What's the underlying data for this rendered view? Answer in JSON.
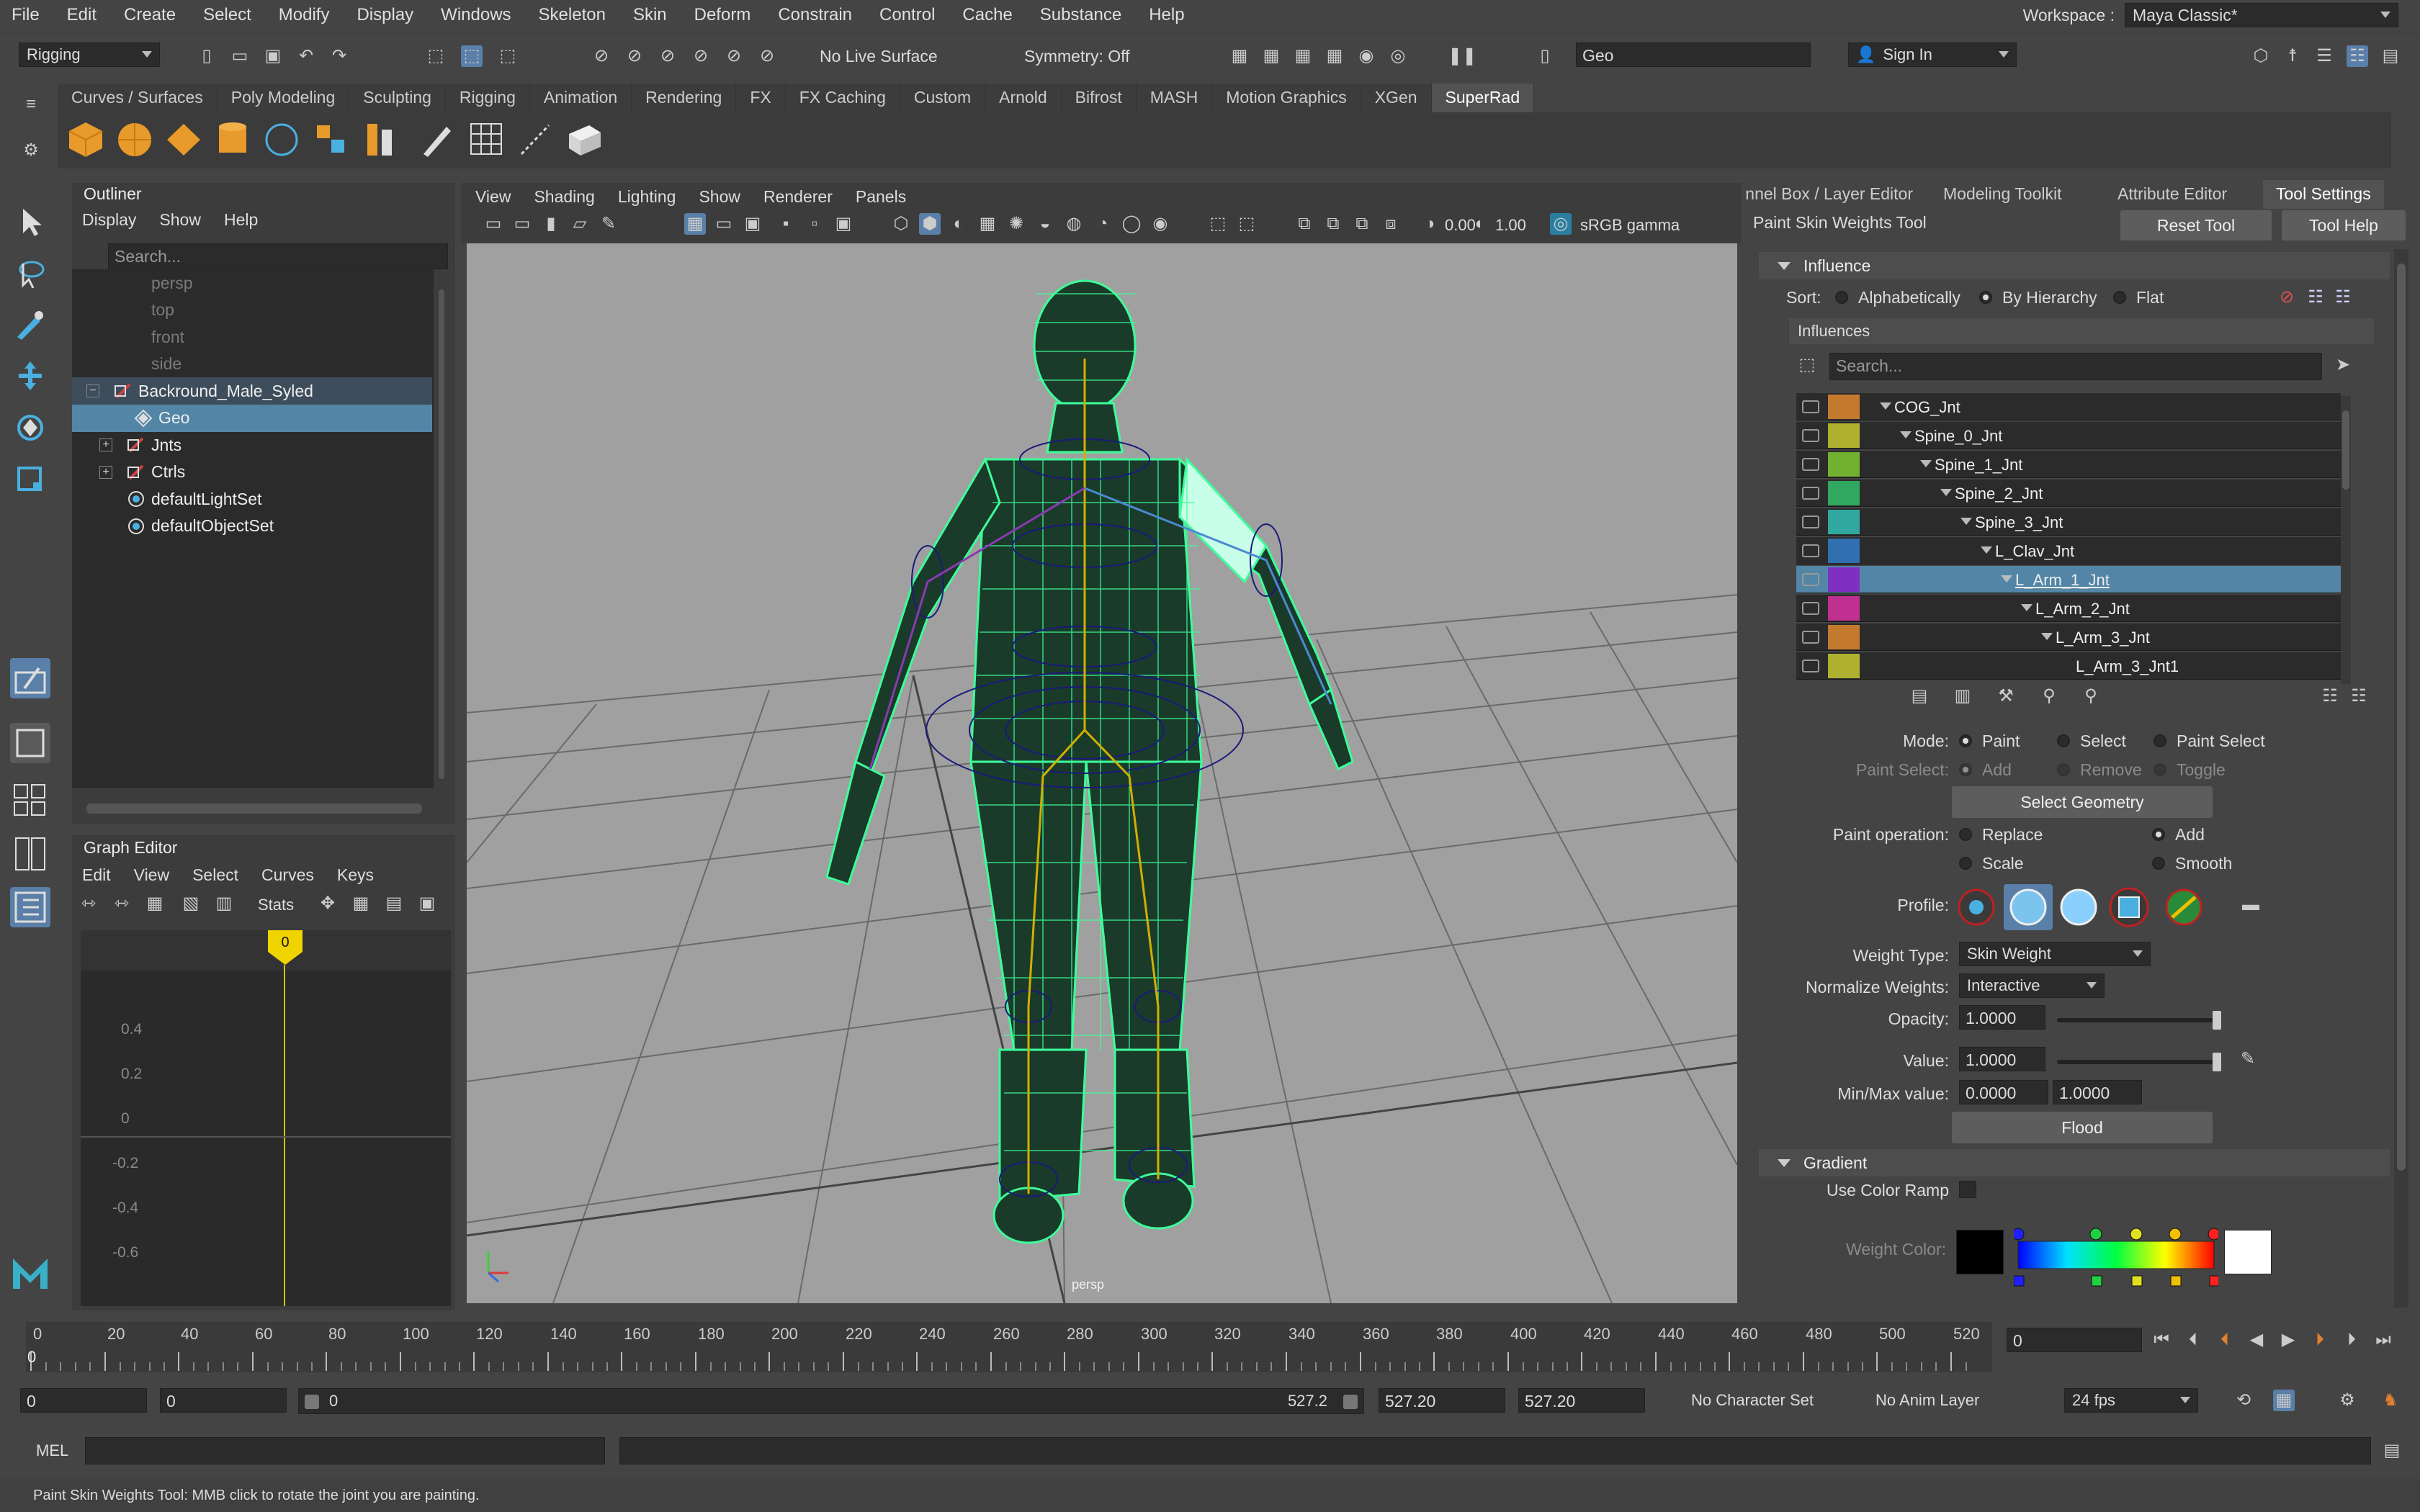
{
  "menubar": {
    "items": [
      "File",
      "Edit",
      "Create",
      "Select",
      "Modify",
      "Display",
      "Windows",
      "Skeleton",
      "Skin",
      "Deform",
      "Constrain",
      "Control",
      "Cache",
      "Substance",
      "Help"
    ],
    "workspace_label": "Workspace :",
    "workspace_value": "Maya Classic*"
  },
  "statusline": {
    "menuset": "Rigging",
    "live_surface": "No Live Surface",
    "symmetry": "Symmetry: Off",
    "name_field": "Geo",
    "sign_in": "Sign In"
  },
  "shelf": {
    "tabs": [
      "Curves / Surfaces",
      "Poly Modeling",
      "Sculpting",
      "Rigging",
      "Animation",
      "Rendering",
      "FX",
      "FX Caching",
      "Custom",
      "Arnold",
      "Bifrost",
      "MASH",
      "Motion Graphics",
      "XGen",
      "SuperRad"
    ],
    "active_tab": "SuperRad"
  },
  "outliner": {
    "title": "Outliner",
    "menu": [
      "Display",
      "Show",
      "Help"
    ],
    "search_placeholder": "Search...",
    "items": [
      {
        "label": "persp",
        "dim": true
      },
      {
        "label": "top",
        "dim": true
      },
      {
        "label": "front",
        "dim": true
      },
      {
        "label": "side",
        "dim": true
      },
      {
        "label": "Backround_Male_Syled",
        "dim": false
      },
      {
        "label": "Geo",
        "dim": false
      },
      {
        "label": "Jnts",
        "dim": false
      },
      {
        "label": "Ctrls",
        "dim": false
      },
      {
        "label": "defaultLightSet",
        "dim": false
      },
      {
        "label": "defaultObjectSet",
        "dim": false
      }
    ]
  },
  "graph_editor": {
    "title": "Graph Editor",
    "menu": [
      "Edit",
      "View",
      "Select",
      "Curves",
      "Keys"
    ],
    "stats": "Stats",
    "current_frame": "0",
    "y_labels": [
      "0.4",
      "0.2",
      "0",
      "-0.2",
      "-0.4",
      "-0.6"
    ]
  },
  "viewport": {
    "menu": [
      "View",
      "Shading",
      "Lighting",
      "Show",
      "Renderer",
      "Panels"
    ],
    "exposure": "0.00",
    "gamma": "1.00",
    "color_space": "sRGB gamma",
    "camera_label": "persp"
  },
  "right_panel": {
    "tabs": [
      "Channel Box / Layer Editor",
      "Modeling Toolkit",
      "Attribute Editor",
      "Tool Settings"
    ],
    "active_tab": "Tool Settings",
    "tool_name": "Paint Skin Weights Tool",
    "reset_tool": "Reset Tool",
    "tool_help": "Tool Help",
    "influence_header": "Influence",
    "sort_label": "Sort:",
    "sort_options": [
      "Alphabetically",
      "By Hierarchy",
      "Flat"
    ],
    "influences_label": "Influences",
    "search_placeholder": "Search...",
    "influences": [
      {
        "name": "COG_Jnt",
        "color": "#c47a2e",
        "depth": 0,
        "selected": false
      },
      {
        "name": "Spine_0_Jnt",
        "color": "#b0b030",
        "depth": 1,
        "selected": false
      },
      {
        "name": "Spine_1_Jnt",
        "color": "#72b030",
        "depth": 2,
        "selected": false
      },
      {
        "name": "Spine_2_Jnt",
        "color": "#30a860",
        "depth": 3,
        "selected": false
      },
      {
        "name": "Spine_3_Jnt",
        "color": "#30a8a0",
        "depth": 4,
        "selected": false
      },
      {
        "name": "L_Clav_Jnt",
        "color": "#3070b0",
        "depth": 5,
        "selected": false
      },
      {
        "name": "L_Arm_1_Jnt",
        "color": "#8030c0",
        "depth": 6,
        "selected": true
      },
      {
        "name": "L_Arm_2_Jnt",
        "color": "#c03090",
        "depth": 7,
        "selected": false
      },
      {
        "name": "L_Arm_3_Jnt",
        "color": "#c47a2e",
        "depth": 8,
        "selected": false
      },
      {
        "name": "L_Arm_3_Jnt1",
        "color": "#b0b030",
        "depth": 9,
        "selected": false
      }
    ],
    "mode_label": "Mode:",
    "mode_options": [
      "Paint",
      "Select",
      "Paint Select"
    ],
    "paint_select_label": "Paint Select:",
    "paint_select_options": [
      "Add",
      "Remove",
      "Toggle"
    ],
    "select_geometry": "Select Geometry",
    "paint_operation_label": "Paint operation:",
    "paint_ops": [
      "Replace",
      "Add",
      "Scale",
      "Smooth"
    ],
    "profile_label": "Profile:",
    "weight_type_label": "Weight Type:",
    "weight_type": "Skin Weight",
    "normalize_label": "Normalize Weights:",
    "normalize": "Interactive",
    "opacity_label": "Opacity:",
    "opacity": "1.0000",
    "value_label": "Value:",
    "value": "1.0000",
    "minmax_label": "Min/Max value:",
    "min": "0.0000",
    "max": "1.0000",
    "flood": "Flood",
    "gradient_header": "Gradient",
    "use_color_ramp": "Use Color Ramp",
    "weight_color_label": "Weight Color:"
  },
  "timeline": {
    "ticks": [
      "0",
      "20",
      "40",
      "60",
      "80",
      "100",
      "120",
      "140",
      "160",
      "180",
      "200",
      "220",
      "240",
      "260",
      "280",
      "300",
      "320",
      "340",
      "360",
      "380",
      "400",
      "420",
      "440",
      "460",
      "480",
      "500",
      "520"
    ],
    "current": "0",
    "frame_field": "0"
  },
  "range": {
    "start": "0",
    "start2": "0",
    "slider_start": "0",
    "slider_end": "527.2",
    "end1": "527.20",
    "end2": "527.20",
    "character_set": "No Character Set",
    "anim_layer": "No Anim Layer",
    "fps": "24 fps"
  },
  "cmdline": {
    "label": "MEL"
  },
  "helpline": {
    "text": "Paint Skin Weights Tool: MMB click to rotate the joint you are painting."
  }
}
